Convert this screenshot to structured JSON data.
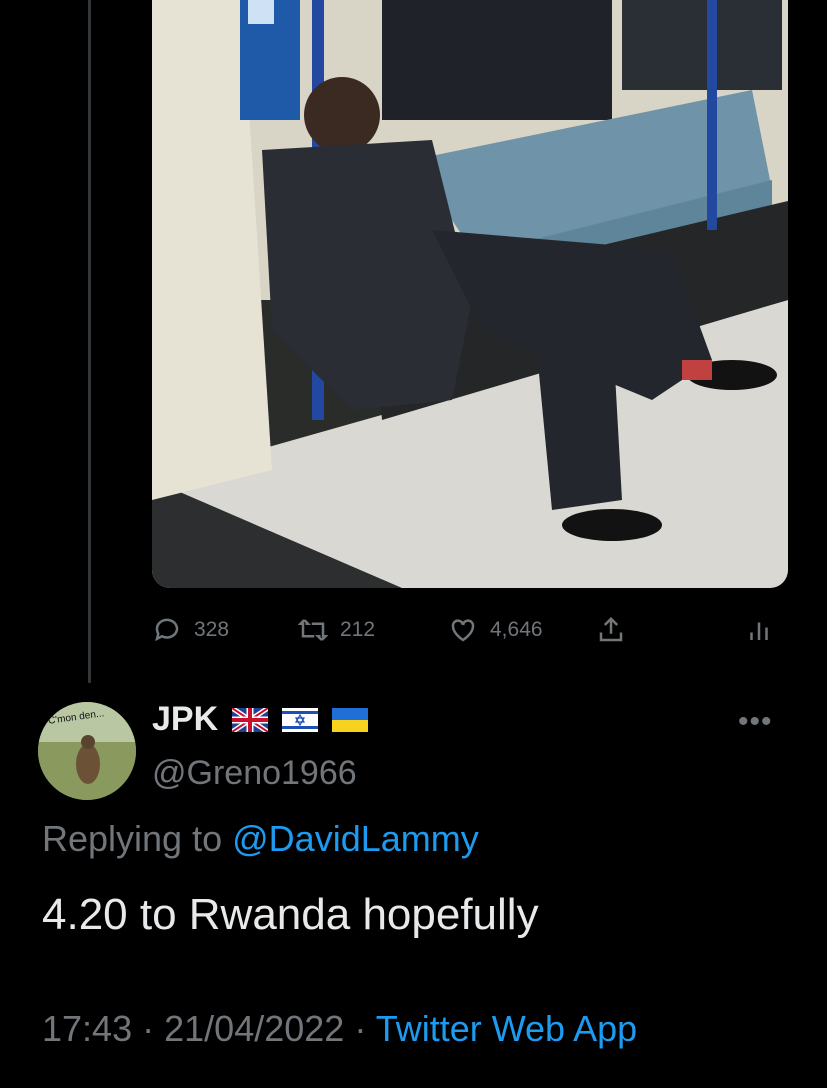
{
  "original_tweet": {
    "stats": {
      "replies": "328",
      "retweets": "212",
      "likes": "4,646"
    }
  },
  "reply": {
    "avatar_caption": "C'mon den...",
    "display_name": "JPK",
    "flags": [
      "uk-flag",
      "israel-flag",
      "ukraine-flag"
    ],
    "handle": "@Greno1966",
    "replying_to_prefix": "Replying to",
    "replying_to_handle": "@DavidLammy",
    "text": "4.20 to Rwanda hopefully",
    "time": "17:43",
    "date": "21/04/2022",
    "separator": "·",
    "source": "Twitter Web App"
  },
  "colors": {
    "background": "#000000",
    "text": "#e7e9ea",
    "muted": "#71767b",
    "link": "#1d9bf0"
  }
}
